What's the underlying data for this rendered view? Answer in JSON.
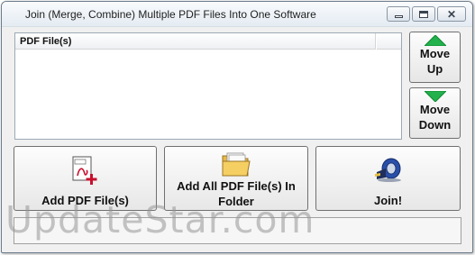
{
  "window": {
    "title": "Join (Merge, Combine) Multiple PDF Files Into One Software"
  },
  "titlebar_buttons": {
    "minimize": "minimize",
    "maximize": "maximize",
    "close": "✕"
  },
  "file_list": {
    "column_header": "PDF File(s)",
    "rows": []
  },
  "side_buttons": {
    "move_up_line1": "Move",
    "move_up_line2": "Up",
    "move_down_line1": "Move",
    "move_down_line2": "Down",
    "arrow_color": "#22b14c"
  },
  "actions": {
    "add_pdf": "Add PDF File(s)",
    "add_all_line1": "Add All PDF File(s) In",
    "add_all_line2": "Folder",
    "join": "Join!"
  },
  "status": {
    "text": ""
  },
  "watermark": "UpdateStar.com",
  "icons": {
    "add_pdf": "pdf-add-icon",
    "add_folder": "folder-icon",
    "join": "tape-dispenser-icon",
    "move_up": "green-up-arrow-icon",
    "move_down": "green-down-arrow-icon"
  }
}
